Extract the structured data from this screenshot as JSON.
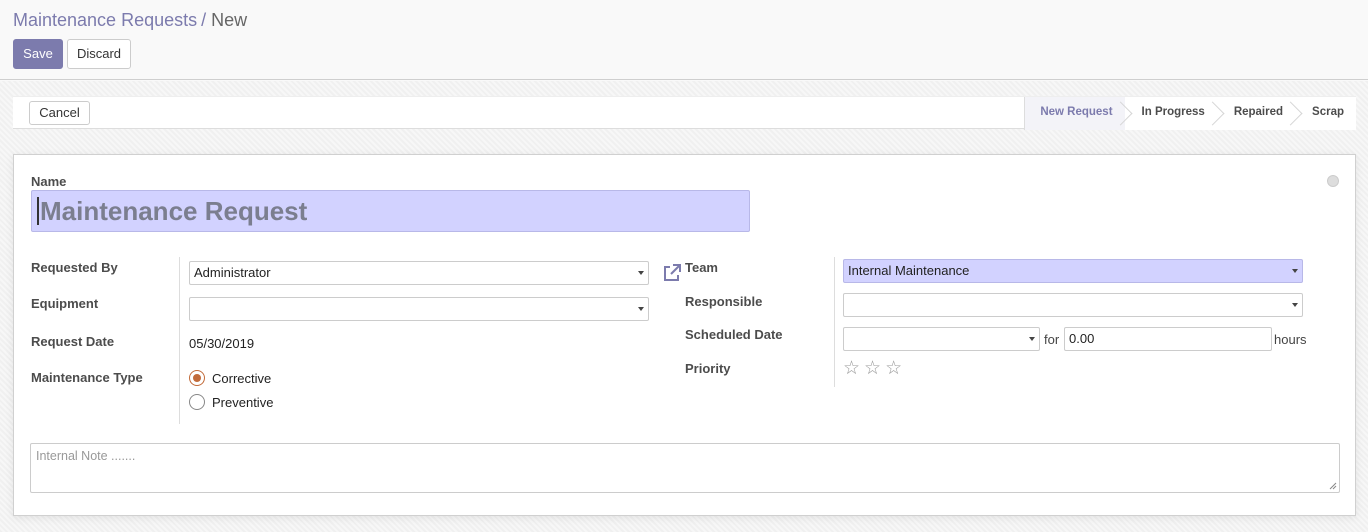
{
  "breadcrumb": {
    "parent": "Maintenance Requests",
    "separator": "/",
    "current": "New"
  },
  "toolbar": {
    "save_label": "Save",
    "discard_label": "Discard"
  },
  "statusbar": {
    "cancel_label": "Cancel",
    "stages": [
      "New Request",
      "In Progress",
      "Repaired",
      "Scrap"
    ],
    "active_stage": "New Request"
  },
  "form": {
    "name_label": "Name",
    "name_value": "Maintenance Request",
    "requested_by": {
      "label": "Requested By",
      "value": "Administrator"
    },
    "equipment": {
      "label": "Equipment",
      "value": ""
    },
    "request_date": {
      "label": "Request Date",
      "value": "05/30/2019"
    },
    "maintenance_type": {
      "label": "Maintenance Type",
      "options": [
        "Corrective",
        "Preventive"
      ],
      "selected": "Corrective"
    },
    "team": {
      "label": "Team",
      "value": "Internal Maintenance"
    },
    "responsible": {
      "label": "Responsible",
      "value": ""
    },
    "scheduled_date": {
      "label": "Scheduled Date",
      "value": "",
      "for_label": "for",
      "duration": "0.00",
      "hours_label": "hours"
    },
    "priority": {
      "label": "Priority",
      "stars": 3,
      "selected": 0
    },
    "internal_note": {
      "placeholder": "Internal Note ......."
    }
  },
  "colors": {
    "accent": "#7c7bad",
    "highlight_field": "#d2d2ff",
    "radio": "#c26b3a"
  }
}
